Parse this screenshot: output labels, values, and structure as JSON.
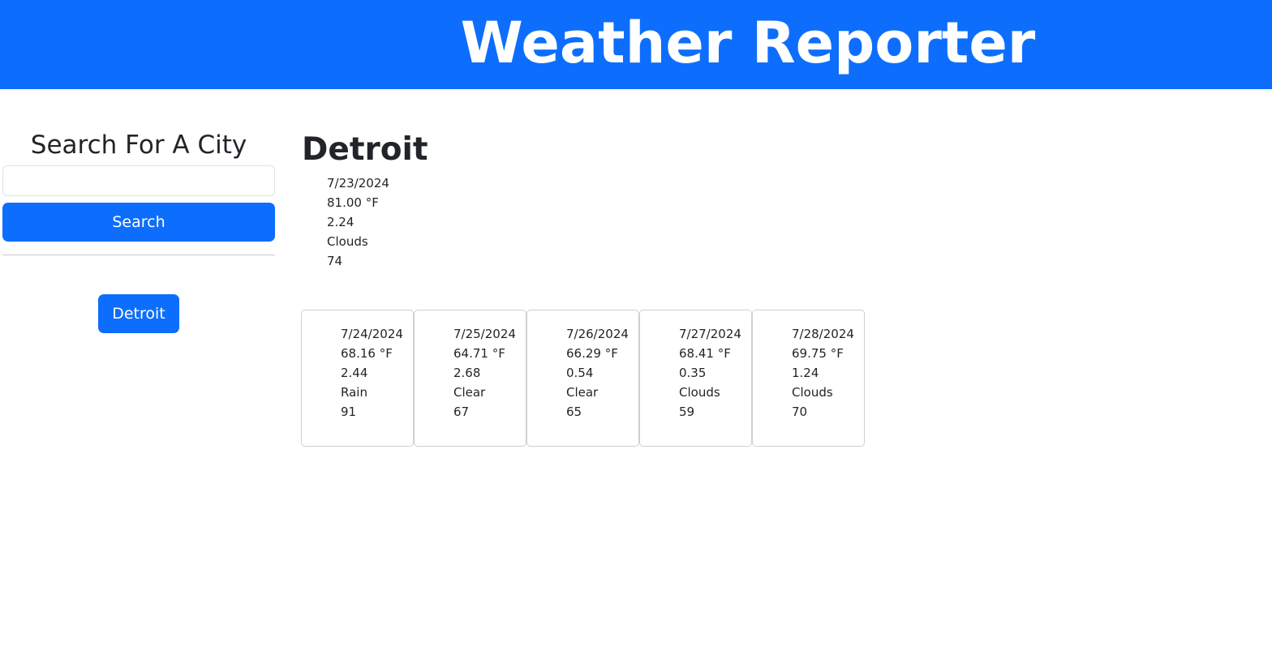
{
  "header": {
    "title": "Weather Reporter"
  },
  "sidebar": {
    "title": "Search For A City",
    "search": {
      "value": "",
      "placeholder": ""
    },
    "search_button_label": "Search",
    "history": [
      "Detroit"
    ]
  },
  "current": {
    "city": "Detroit",
    "date": "7/23/2024",
    "temp": "81.00 °F",
    "wind": "2.24",
    "condition": "Clouds",
    "humidity": "74"
  },
  "forecast": [
    {
      "date": "7/24/2024",
      "temp": "68.16 °F",
      "wind": "2.44",
      "condition": "Rain",
      "humidity": "91"
    },
    {
      "date": "7/25/2024",
      "temp": "64.71 °F",
      "wind": "2.68",
      "condition": "Clear",
      "humidity": "67"
    },
    {
      "date": "7/26/2024",
      "temp": "66.29 °F",
      "wind": "0.54",
      "condition": "Clear",
      "humidity": "65"
    },
    {
      "date": "7/27/2024",
      "temp": "68.41 °F",
      "wind": "0.35",
      "condition": "Clouds",
      "humidity": "59"
    },
    {
      "date": "7/28/2024",
      "temp": "69.75 °F",
      "wind": "1.24",
      "condition": "Clouds",
      "humidity": "70"
    }
  ],
  "colors": {
    "accent": "#0d6efd",
    "text": "#212529",
    "border": "#cfcfcf"
  }
}
